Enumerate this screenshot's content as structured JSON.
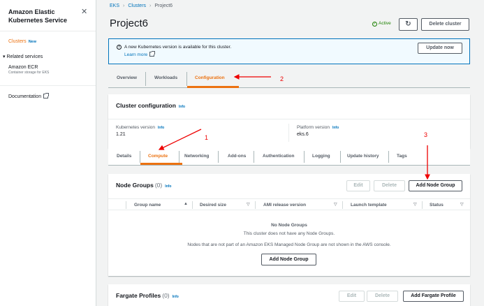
{
  "sidebar": {
    "title": "Amazon Elastic Kubernetes Service",
    "clusters_label": "Clusters",
    "new_badge": "New",
    "related_label": "Related services",
    "ecr_label": "Amazon ECR",
    "ecr_sub": "Container storage for EKS",
    "documentation_label": "Documentation"
  },
  "breadcrumb": {
    "items": [
      "EKS",
      "Clusters",
      "Project6"
    ]
  },
  "page": {
    "title": "Project6",
    "status": "Active",
    "refresh_icon": "↻",
    "delete_cluster": "Delete cluster"
  },
  "alert": {
    "text": "A new Kubernetes version is available for this cluster.",
    "link": "Learn more",
    "button": "Update now"
  },
  "main_tabs": [
    "Overview",
    "Workloads",
    "Configuration"
  ],
  "cluster_config": {
    "title": "Cluster configuration",
    "info": "Info",
    "k8s_label": "Kubernetes version",
    "k8s_value": "1.21",
    "platform_label": "Platform version",
    "platform_value": "eks.6"
  },
  "sub_tabs": [
    "Details",
    "Compute",
    "Networking",
    "Add-ons",
    "Authentication",
    "Logging",
    "Update history",
    "Tags"
  ],
  "node_groups": {
    "title": "Node Groups",
    "count": "(0)",
    "info": "Info",
    "edit": "Edit",
    "delete": "Delete",
    "add": "Add Node Group",
    "columns": [
      "Group name",
      "Desired size",
      "AMI release version",
      "Launch template",
      "Status"
    ],
    "empty_title": "No Node Groups",
    "empty_sub": "This cluster does not have any Node Groups.",
    "empty_note": "Nodes that are not part of an Amazon EKS Managed Node Group are not shown in the AWS console.",
    "empty_button": "Add Node Group"
  },
  "fargate": {
    "title": "Fargate Profiles",
    "count": "(0)",
    "info": "Info",
    "edit": "Edit",
    "delete": "Delete",
    "add": "Add Fargate Profile"
  },
  "annotations": {
    "one": "1",
    "two": "2",
    "three": "3"
  },
  "colors": {
    "accent": "#ec7211",
    "link": "#0073bb",
    "annotation": "#ee0000",
    "active": "#1d8102"
  }
}
